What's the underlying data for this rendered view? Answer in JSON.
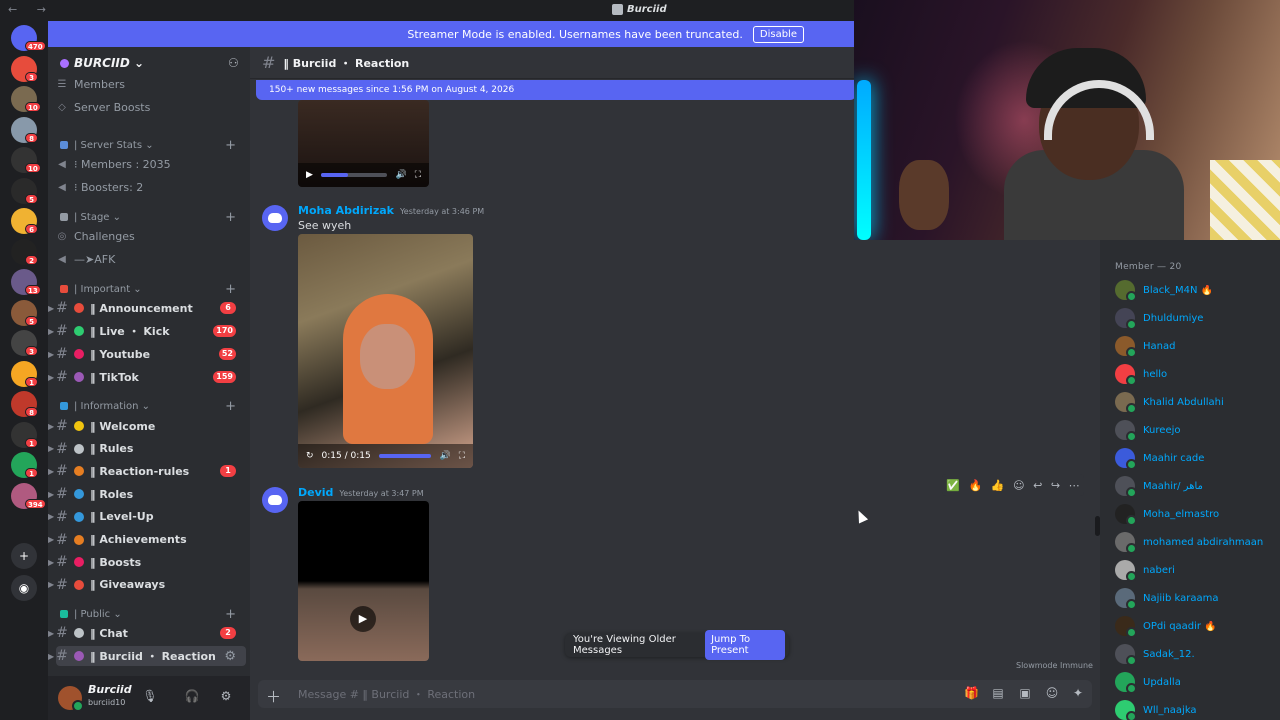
{
  "window": {
    "title": "Burciid",
    "nav_arrows": "← →"
  },
  "streamer_bar": {
    "text": "Streamer Mode is enabled. Usernames have been truncated.",
    "disable_label": "Disable"
  },
  "guild_badges": [
    "470",
    "3",
    "10",
    "8",
    "10",
    "5",
    "6",
    "2",
    "13",
    "5",
    "3",
    "1",
    "8",
    "1",
    "1",
    "394"
  ],
  "server": {
    "name": "BURCIID ⌄"
  },
  "sidebar": {
    "top": [
      "Members",
      "Server Boosts"
    ],
    "server_stats": {
      "title": "| Server Stats ⌄",
      "items": [
        "⁝ Members : 2035",
        "⁝ Boosters: 2"
      ]
    },
    "stage": {
      "title": "| Stage ⌄",
      "items": [
        "Challenges",
        "—➤AFK"
      ]
    },
    "important": {
      "title": "| Important ⌄",
      "items": [
        {
          "label": "‖ Announcement",
          "badge": "6",
          "color": "#e74c3c"
        },
        {
          "label": "‖ Live ・ Kick",
          "badge": "170",
          "color": "#2ecc71"
        },
        {
          "label": "‖ Youtube",
          "badge": "52",
          "color": "#e91e63"
        },
        {
          "label": "‖ TikTok",
          "badge": "159",
          "color": "#9b59b6"
        }
      ]
    },
    "information": {
      "title": "| Information ⌄",
      "items": [
        {
          "label": "‖ Welcome",
          "badge": "",
          "color": "#f1c40f"
        },
        {
          "label": "‖ Rules",
          "badge": "",
          "color": "#bdc3c7"
        },
        {
          "label": "‖ Reaction-rules",
          "badge": "1",
          "color": "#e67e22"
        },
        {
          "label": "‖ Roles",
          "badge": "",
          "color": "#3498db"
        },
        {
          "label": "‖ Level-Up",
          "badge": "",
          "color": "#3498db"
        },
        {
          "label": "‖ Achievements",
          "badge": "",
          "color": "#e67e22"
        },
        {
          "label": "‖ Boosts",
          "badge": "",
          "color": "#e91e63"
        },
        {
          "label": "‖ Giveaways",
          "badge": "",
          "color": "#e74c3c"
        }
      ]
    },
    "public": {
      "title": "| Public ⌄",
      "items": [
        {
          "label": "‖ Chat",
          "badge": "2",
          "color": "#bdc3c7"
        },
        {
          "label": "‖ Burciid ・ Reaction",
          "badge": "",
          "color": "#9b59b6"
        }
      ]
    }
  },
  "user": {
    "name": "Burciid",
    "tag": "burciid10"
  },
  "chat": {
    "channel": "‖ Burciid ・ Reaction",
    "new_banner": "150+ new messages since 1:56 PM on August 4, 2026",
    "messages": [
      {
        "author": "Moha Abdirizak",
        "time": "Yesterday at 3:46 PM",
        "text": "See wyeh",
        "video_time": "0:15 / 0:15"
      },
      {
        "author": "Devid",
        "time": "Yesterday at 3:47 PM",
        "text": ""
      }
    ],
    "older_text": "You're Viewing Older Messages",
    "jump_label": "Jump To Present",
    "slowmode": "Slowmode Immune",
    "composer_placeholder": "Message # ‖ Burciid ・ Reaction"
  },
  "members": {
    "header": "Member — 20",
    "list": [
      {
        "name": "Black_M4N 🔥",
        "color": "#556b2f"
      },
      {
        "name": "Dhuldumiye",
        "color": "#445"
      },
      {
        "name": "Hanad",
        "color": "#8b5a2b"
      },
      {
        "name": "hello",
        "color": "#f23f43"
      },
      {
        "name": "Khalid Abdullahi",
        "color": "#7a6a50"
      },
      {
        "name": "Kureejo",
        "color": "#4e5058"
      },
      {
        "name": "Maahir cade",
        "color": "#3b5bdb"
      },
      {
        "name": "Maahir/ ماهر",
        "color": "#4e5058"
      },
      {
        "name": "Moha_elmastro",
        "color": "#222"
      },
      {
        "name": "mohamed abdirahmaan",
        "color": "#6a6a6a"
      },
      {
        "name": "naberi",
        "color": "#aaa"
      },
      {
        "name": "Najiib karaama",
        "color": "#5a6a7a"
      },
      {
        "name": "OPdi qaadir 🔥",
        "color": "#3a2a1a"
      },
      {
        "name": "Sadak_12.",
        "color": "#4e5058"
      },
      {
        "name": "Updalla",
        "color": "#23a55a"
      },
      {
        "name": "Wll_naajka",
        "color": "#2ecc71"
      }
    ]
  }
}
